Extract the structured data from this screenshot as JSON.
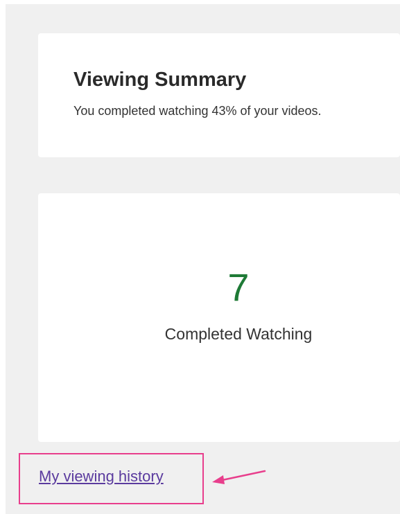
{
  "summary": {
    "title": "Viewing Summary",
    "text": "You completed watching 43% of your videos."
  },
  "stats": {
    "completed_value": "7",
    "completed_label": "Completed Watching"
  },
  "links": {
    "history_label": "My viewing history"
  },
  "annotation": {
    "color": "#e83e8c"
  },
  "colors": {
    "page_background": "#f0f0f0",
    "stat_value": "#1e7a36",
    "link": "#5a3a9e"
  }
}
